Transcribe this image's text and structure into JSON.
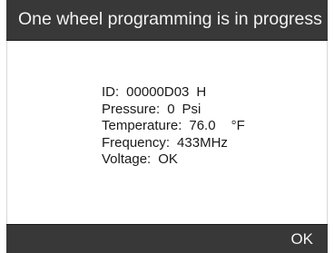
{
  "dialog": {
    "title": "One wheel programming is in progress",
    "ok_label": "OK"
  },
  "sensor_info": {
    "id_label": "ID:",
    "id_value": "00000D03",
    "id_suffix": "H",
    "pressure_label": "Pressure:",
    "pressure_value": "0",
    "pressure_unit": "Psi",
    "temperature_label": "Temperature:",
    "temperature_value": "76.0",
    "temperature_unit": "°F",
    "frequency_label": "Frequency:",
    "frequency_value": "433MHz",
    "voltage_label": "Voltage:",
    "voltage_value": "OK"
  },
  "colors": {
    "bar_background": "#383838",
    "bar_text": "#f2f2f2",
    "content_background": "#ffffff",
    "content_text": "#1a1a1a"
  }
}
